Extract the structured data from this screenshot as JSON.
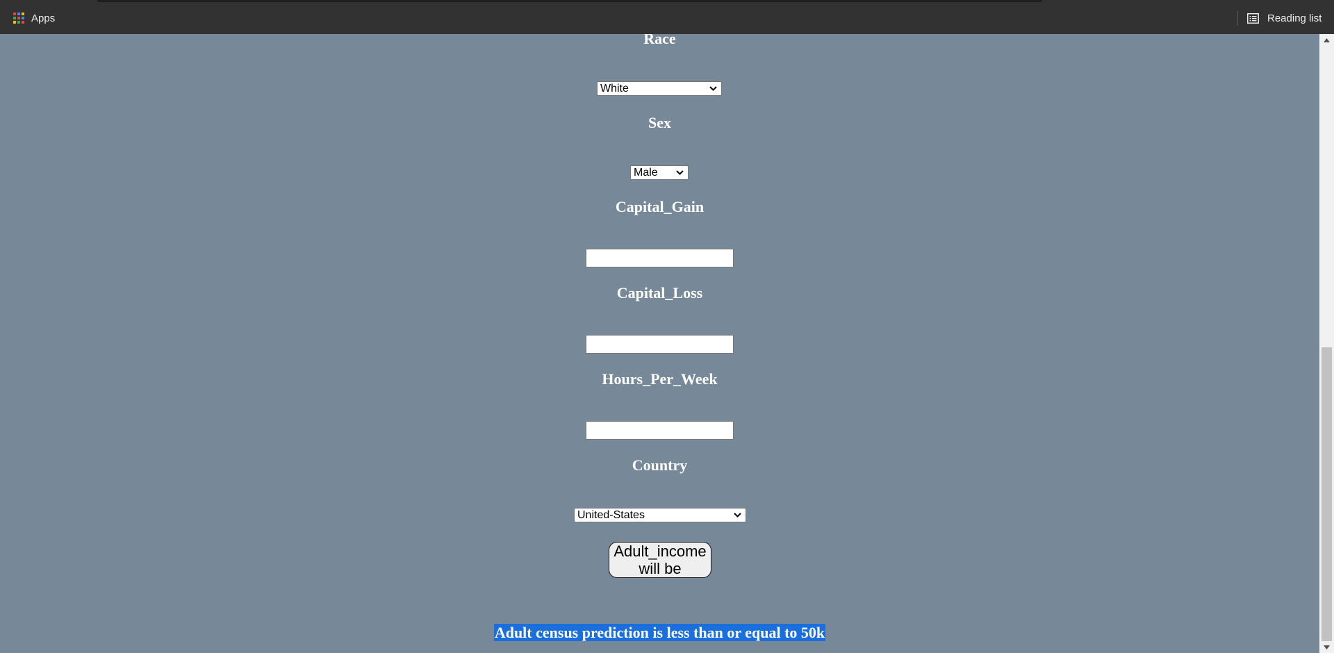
{
  "browser": {
    "apps_label": "Apps",
    "reading_list_label": "Reading list",
    "apps_icon": "apps-grid-icon",
    "reading_list_icon": "reading-list-icon"
  },
  "form": {
    "race": {
      "label": "Race",
      "selected": "White"
    },
    "sex": {
      "label": "Sex",
      "selected": "Male"
    },
    "capital_gain": {
      "label": "Capital_Gain",
      "value": ""
    },
    "capital_loss": {
      "label": "Capital_Loss",
      "value": ""
    },
    "hours_per_week": {
      "label": "Hours_Per_Week",
      "value": ""
    },
    "country": {
      "label": "Country",
      "selected": "United-States"
    },
    "submit": {
      "line1": "Adult_income",
      "line2": "will be"
    }
  },
  "result": {
    "text": "Adult census prediction is less than or equal to 50k"
  },
  "colors": {
    "page_background": "#778899",
    "browser_bar": "#323232",
    "result_highlight": "#1a6fdc"
  }
}
